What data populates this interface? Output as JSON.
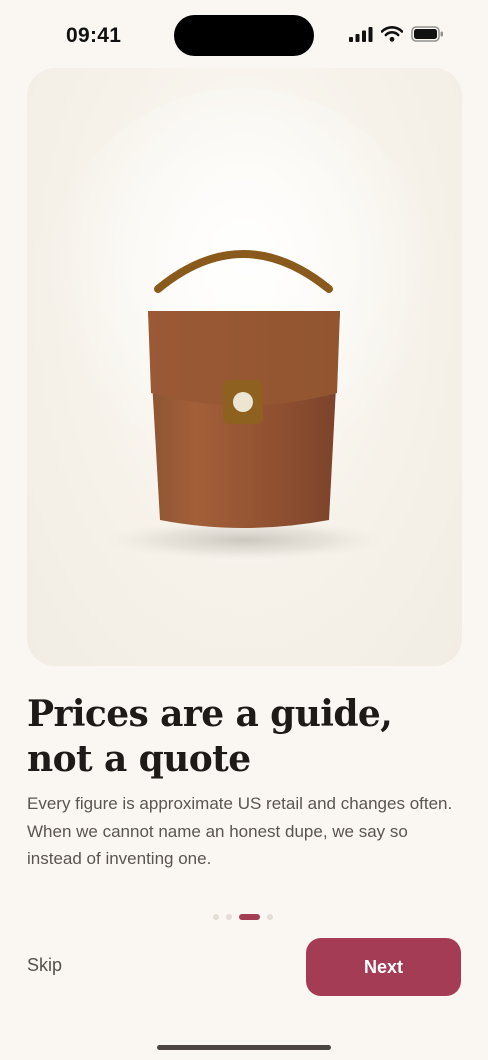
{
  "status_bar": {
    "time": "09:41",
    "icons": [
      "cellular-signal-icon",
      "wifi-icon",
      "battery-icon"
    ]
  },
  "hero": {
    "illustration": "handbag-illustration",
    "colors": {
      "bag": "#9b5632",
      "handle": "#8a5a1c",
      "clasp": "#8f6120",
      "background": "#f3efe8"
    }
  },
  "onboarding": {
    "title": "Prices are a guide, not a quote",
    "body": "Every figure is approximate US retail and changes often. When we cannot name an honest dupe, we say so instead of inventing one."
  },
  "pagination": {
    "total": 4,
    "current": 3
  },
  "actions": {
    "skip_label": "Skip",
    "next_label": "Next"
  },
  "colors": {
    "accent": "#a33c54",
    "background": "#faf7f3",
    "text": "#1e1a17",
    "muted_text": "#5a5550"
  }
}
